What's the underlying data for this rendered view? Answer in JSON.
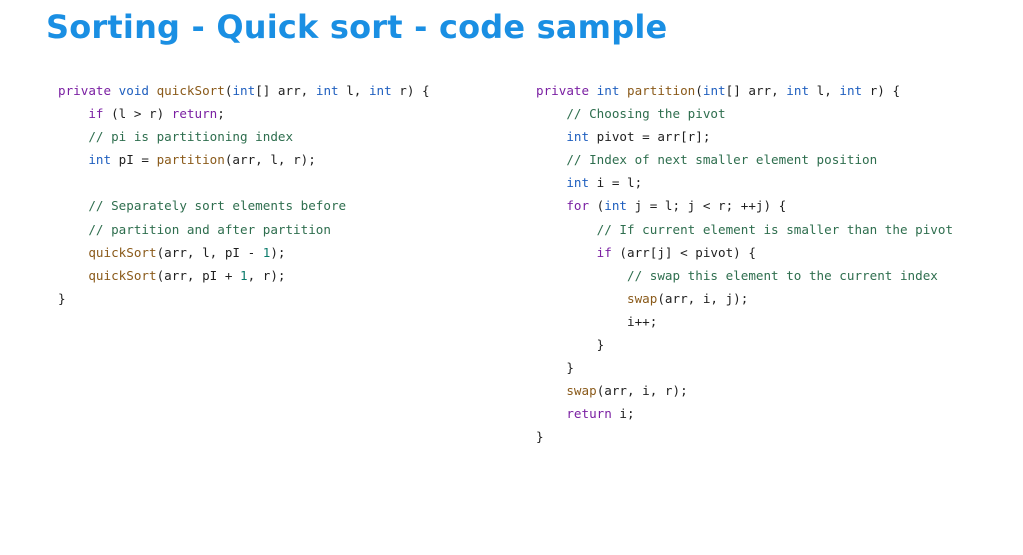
{
  "slide": {
    "title": "Sorting - Quick sort - code sample"
  },
  "colors": {
    "title": "#1a8fe3",
    "keyword": "#7a1fa2",
    "type": "#1f5fbf",
    "function": "#8a5a1a",
    "comment": "#2e6e4e",
    "number": "#0a7a6a",
    "text": "#1f1f1f"
  },
  "code_left": {
    "lines": [
      [
        [
          "kw",
          "private "
        ],
        [
          "ty",
          "void "
        ],
        [
          "fn",
          "quickSort"
        ],
        [
          "pl",
          "("
        ],
        [
          "ty",
          "int"
        ],
        [
          "pl",
          "[] arr, "
        ],
        [
          "ty",
          "int"
        ],
        [
          "pl",
          " l, "
        ],
        [
          "ty",
          "int"
        ],
        [
          "pl",
          " r) {"
        ]
      ],
      [
        [
          "pl",
          "    "
        ],
        [
          "kw",
          "if"
        ],
        [
          "pl",
          " (l > r) "
        ],
        [
          "kw",
          "return"
        ],
        [
          "pl",
          ";"
        ]
      ],
      [
        [
          "pl",
          "    "
        ],
        [
          "cm",
          "// pi is partitioning index"
        ]
      ],
      [
        [
          "pl",
          "    "
        ],
        [
          "ty",
          "int"
        ],
        [
          "pl",
          " pI = "
        ],
        [
          "fn",
          "partition"
        ],
        [
          "pl",
          "(arr, l, r);"
        ]
      ],
      [
        [
          "pl",
          ""
        ]
      ],
      [
        [
          "pl",
          "    "
        ],
        [
          "cm",
          "// Separately sort elements before"
        ]
      ],
      [
        [
          "pl",
          "    "
        ],
        [
          "cm",
          "// partition and after partition"
        ]
      ],
      [
        [
          "pl",
          "    "
        ],
        [
          "fn",
          "quickSort"
        ],
        [
          "pl",
          "(arr, l, pI - "
        ],
        [
          "nm",
          "1"
        ],
        [
          "pl",
          ");"
        ]
      ],
      [
        [
          "pl",
          "    "
        ],
        [
          "fn",
          "quickSort"
        ],
        [
          "pl",
          "(arr, pI + "
        ],
        [
          "nm",
          "1"
        ],
        [
          "pl",
          ", r);"
        ]
      ],
      [
        [
          "pl",
          "}"
        ]
      ]
    ]
  },
  "code_right": {
    "lines": [
      [
        [
          "kw",
          "private "
        ],
        [
          "ty",
          "int "
        ],
        [
          "fn",
          "partition"
        ],
        [
          "pl",
          "("
        ],
        [
          "ty",
          "int"
        ],
        [
          "pl",
          "[] arr, "
        ],
        [
          "ty",
          "int"
        ],
        [
          "pl",
          " l, "
        ],
        [
          "ty",
          "int"
        ],
        [
          "pl",
          " r) {"
        ]
      ],
      [
        [
          "pl",
          "    "
        ],
        [
          "cm",
          "// Choosing the pivot"
        ]
      ],
      [
        [
          "pl",
          "    "
        ],
        [
          "ty",
          "int"
        ],
        [
          "pl",
          " pivot = arr[r];"
        ]
      ],
      [
        [
          "pl",
          "    "
        ],
        [
          "cm",
          "// Index of next smaller element position"
        ]
      ],
      [
        [
          "pl",
          "    "
        ],
        [
          "ty",
          "int"
        ],
        [
          "pl",
          " i = l;"
        ]
      ],
      [
        [
          "pl",
          "    "
        ],
        [
          "kw",
          "for"
        ],
        [
          "pl",
          " ("
        ],
        [
          "ty",
          "int"
        ],
        [
          "pl",
          " j = l; j < r; ++j) {"
        ]
      ],
      [
        [
          "pl",
          "        "
        ],
        [
          "cm",
          "// If current element is smaller than the pivot"
        ]
      ],
      [
        [
          "pl",
          "        "
        ],
        [
          "kw",
          "if"
        ],
        [
          "pl",
          " (arr[j] < pivot) {"
        ]
      ],
      [
        [
          "pl",
          "            "
        ],
        [
          "cm",
          "// swap this element to the current index"
        ]
      ],
      [
        [
          "pl",
          "            "
        ],
        [
          "fn",
          "swap"
        ],
        [
          "pl",
          "(arr, i, j);"
        ]
      ],
      [
        [
          "pl",
          "            i++;"
        ]
      ],
      [
        [
          "pl",
          "        }"
        ]
      ],
      [
        [
          "pl",
          "    }"
        ]
      ],
      [
        [
          "pl",
          "    "
        ],
        [
          "fn",
          "swap"
        ],
        [
          "pl",
          "(arr, i, r);"
        ]
      ],
      [
        [
          "pl",
          "    "
        ],
        [
          "kw",
          "return"
        ],
        [
          "pl",
          " i;"
        ]
      ],
      [
        [
          "pl",
          "}"
        ]
      ]
    ]
  }
}
